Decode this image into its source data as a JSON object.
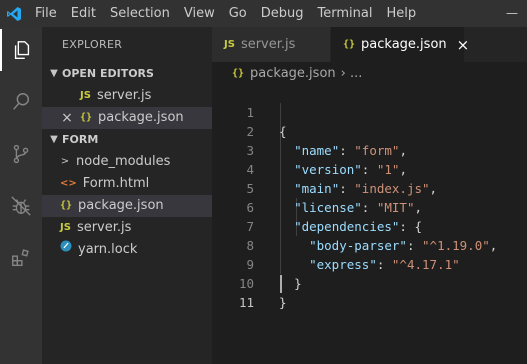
{
  "menu": [
    "File",
    "Edit",
    "Selection",
    "View",
    "Go",
    "Debug",
    "Terminal",
    "Help"
  ],
  "explorer": {
    "title": "EXPLORER",
    "open_editors_label": "OPEN EDITORS",
    "open_editors": [
      {
        "icon": "JS",
        "name": "server.js"
      },
      {
        "icon": "{}",
        "name": "package.json"
      }
    ],
    "folder_label": "FORM",
    "files": [
      {
        "icon": ">",
        "name": "node_modules"
      },
      {
        "icon": "<>",
        "name": "Form.html"
      },
      {
        "icon": "{}",
        "name": "package.json"
      },
      {
        "icon": "JS",
        "name": "server.js"
      },
      {
        "icon": "yarn",
        "name": "yarn.lock"
      }
    ]
  },
  "tabs": [
    {
      "icon": "JS",
      "label": "server.js"
    },
    {
      "icon": "{}",
      "label": "package.json",
      "close": "×"
    }
  ],
  "breadcrumb": {
    "icon": "{}",
    "file": "package.json",
    "sep": "› ..."
  },
  "code": {
    "line_numbers": [
      "1",
      "2",
      "3",
      "4",
      "5",
      "6",
      "7",
      "8",
      "9",
      "10",
      "11"
    ],
    "l1": "{",
    "l2k": "\"name\"",
    "l2v": "\"form\"",
    "l3k": "\"version\"",
    "l3v": "\"1\"",
    "l4k": "\"main\"",
    "l4v": "\"index.js\"",
    "l5k": "\"license\"",
    "l5v": "\"MIT\"",
    "l6k": "\"dependencies\"",
    "l7k": "\"body-parser\"",
    "l7v": "\"^1.19.0\"",
    "l8k": "\"express\"",
    "l8v": "\"^4.17.1\"",
    "l9": "}",
    "l10": "}"
  },
  "colors": {
    "key": "#9cdcfe",
    "string": "#ce9178",
    "accent": "#007acc"
  }
}
